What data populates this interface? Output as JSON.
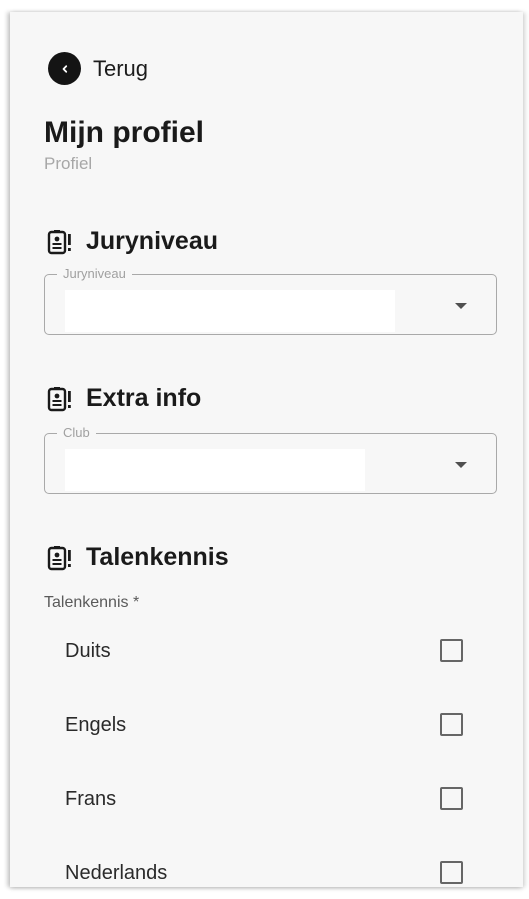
{
  "back": {
    "label": "Terug"
  },
  "page": {
    "title": "Mijn profiel",
    "subtitle": "Profiel"
  },
  "sections": {
    "juryniveau": {
      "title": "Juryniveau",
      "icon": "badge-alert-icon",
      "field": {
        "label": "Juryniveau",
        "value": ""
      }
    },
    "extra_info": {
      "title": "Extra info",
      "icon": "badge-alert-icon",
      "field": {
        "label": "Club",
        "value": ""
      }
    },
    "talenkennis": {
      "title": "Talenkennis",
      "icon": "badge-alert-icon",
      "group_label": "Talenkennis *",
      "options": [
        {
          "label": "Duits",
          "checked": false
        },
        {
          "label": "Engels",
          "checked": false
        },
        {
          "label": "Frans",
          "checked": false
        },
        {
          "label": "Nederlands",
          "checked": false
        }
      ]
    }
  }
}
